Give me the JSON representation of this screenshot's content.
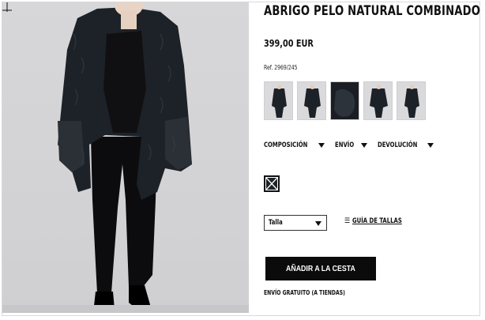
{
  "product": {
    "title": "ABRIGO PELO NATURAL COMBINADO",
    "price": "399,00 EUR",
    "reference": "Ref. 2969/245"
  },
  "gallery": {
    "thumbnails": [
      {
        "alt": "view-1"
      },
      {
        "alt": "view-2"
      },
      {
        "alt": "view-3"
      },
      {
        "alt": "view-4"
      },
      {
        "alt": "view-5"
      }
    ]
  },
  "info_tabs": [
    {
      "label": "COMPOSICIÓN"
    },
    {
      "label": "ENVÍO"
    },
    {
      "label": "DEVOLUCIÓN"
    }
  ],
  "color_swatch": {
    "icon": "black-swatch-icon"
  },
  "size": {
    "selected": "Talla",
    "guide_label": "GUÍA DE TALLAS",
    "guide_icon": "size-guide-icon"
  },
  "cart": {
    "button_label": "AÑADIR A LA CESTA"
  },
  "shipping_note": "ENVÍO GRATUITO (A TIENDAS)",
  "colors": {
    "button": "#0b0b0b",
    "photo_background": "#d7d7d9",
    "coat": "#1d2228"
  }
}
